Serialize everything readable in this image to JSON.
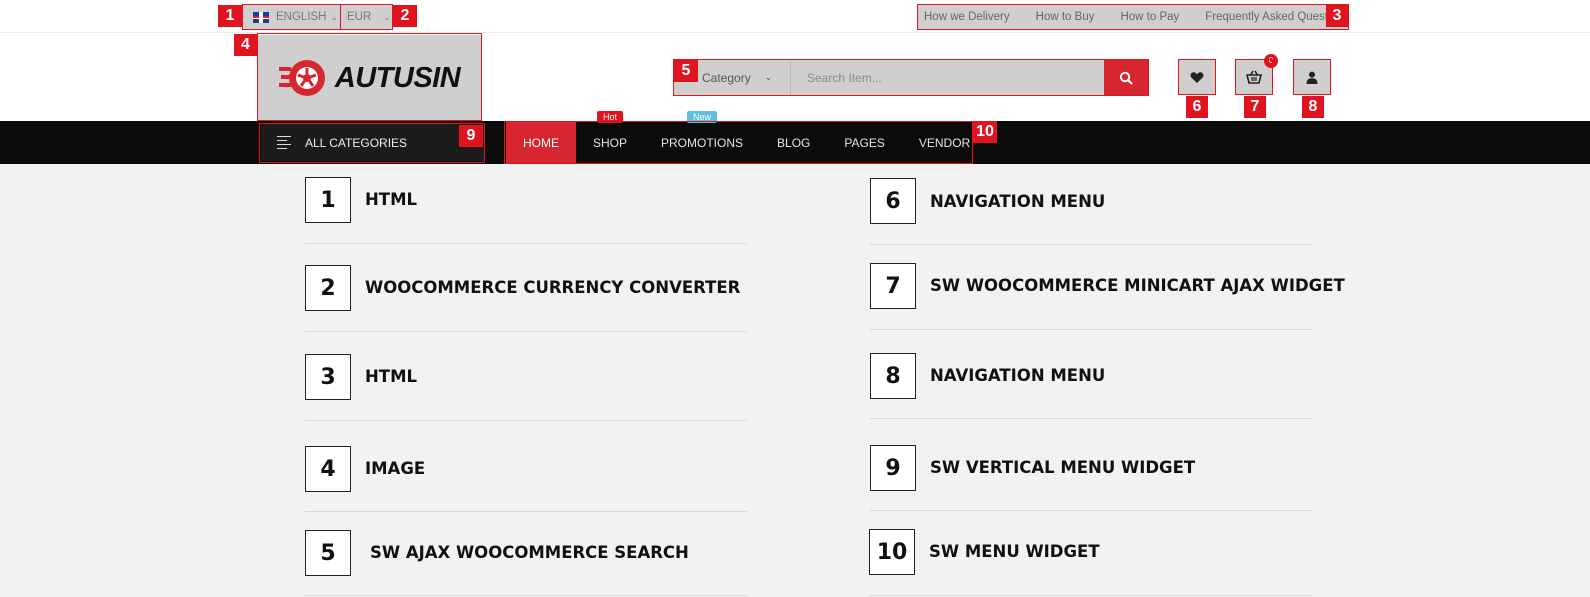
{
  "topbar": {
    "language": "ENGLISH",
    "currency": "EUR",
    "links": [
      "How we Delivery",
      "How to Buy",
      "How to Pay",
      "Frequently Asked Questions"
    ]
  },
  "header": {
    "logo_text": "AUTUSIN",
    "search": {
      "category_label": "Category",
      "placeholder": "Search Item..."
    },
    "cart_count": "0"
  },
  "nav": {
    "all_categories": "ALL CATEGORIES",
    "items": [
      {
        "label": "HOME",
        "badge": ""
      },
      {
        "label": "SHOP",
        "badge": "Hot"
      },
      {
        "label": "PROMOTIONS",
        "badge": "New"
      },
      {
        "label": "BLOG",
        "badge": ""
      },
      {
        "label": "PAGES",
        "badge": ""
      },
      {
        "label": "VENDOR",
        "badge": ""
      }
    ]
  },
  "annotations": {
    "tags": [
      "1",
      "2",
      "3",
      "4",
      "5",
      "6",
      "7",
      "8",
      "9",
      "10"
    ],
    "legend": [
      {
        "num": "1",
        "label": "HTML"
      },
      {
        "num": "2",
        "label": "WOOCOMMERCE CURRENCY CONVERTER"
      },
      {
        "num": "3",
        "label": "HTML"
      },
      {
        "num": "4",
        "label": "IMAGE"
      },
      {
        "num": "5",
        "label": "SW AJAX WOOCOMMERCE SEARCH"
      },
      {
        "num": "6",
        "label": "NAVIGATION MENU"
      },
      {
        "num": "7",
        "label": "SW WOOCOMMERCE MINICART AJAX WIDGET"
      },
      {
        "num": "8",
        "label": "NAVIGATION MENU"
      },
      {
        "num": "9",
        "label": "SW VERTICAL MENU WIDGET"
      },
      {
        "num": "10",
        "label": "SW MENU WIDGET"
      }
    ]
  },
  "colors": {
    "accent": "#d6262f",
    "annotation": "#e0141e",
    "hot_badge": "#e0141e",
    "new_badge": "#5bc0de"
  }
}
